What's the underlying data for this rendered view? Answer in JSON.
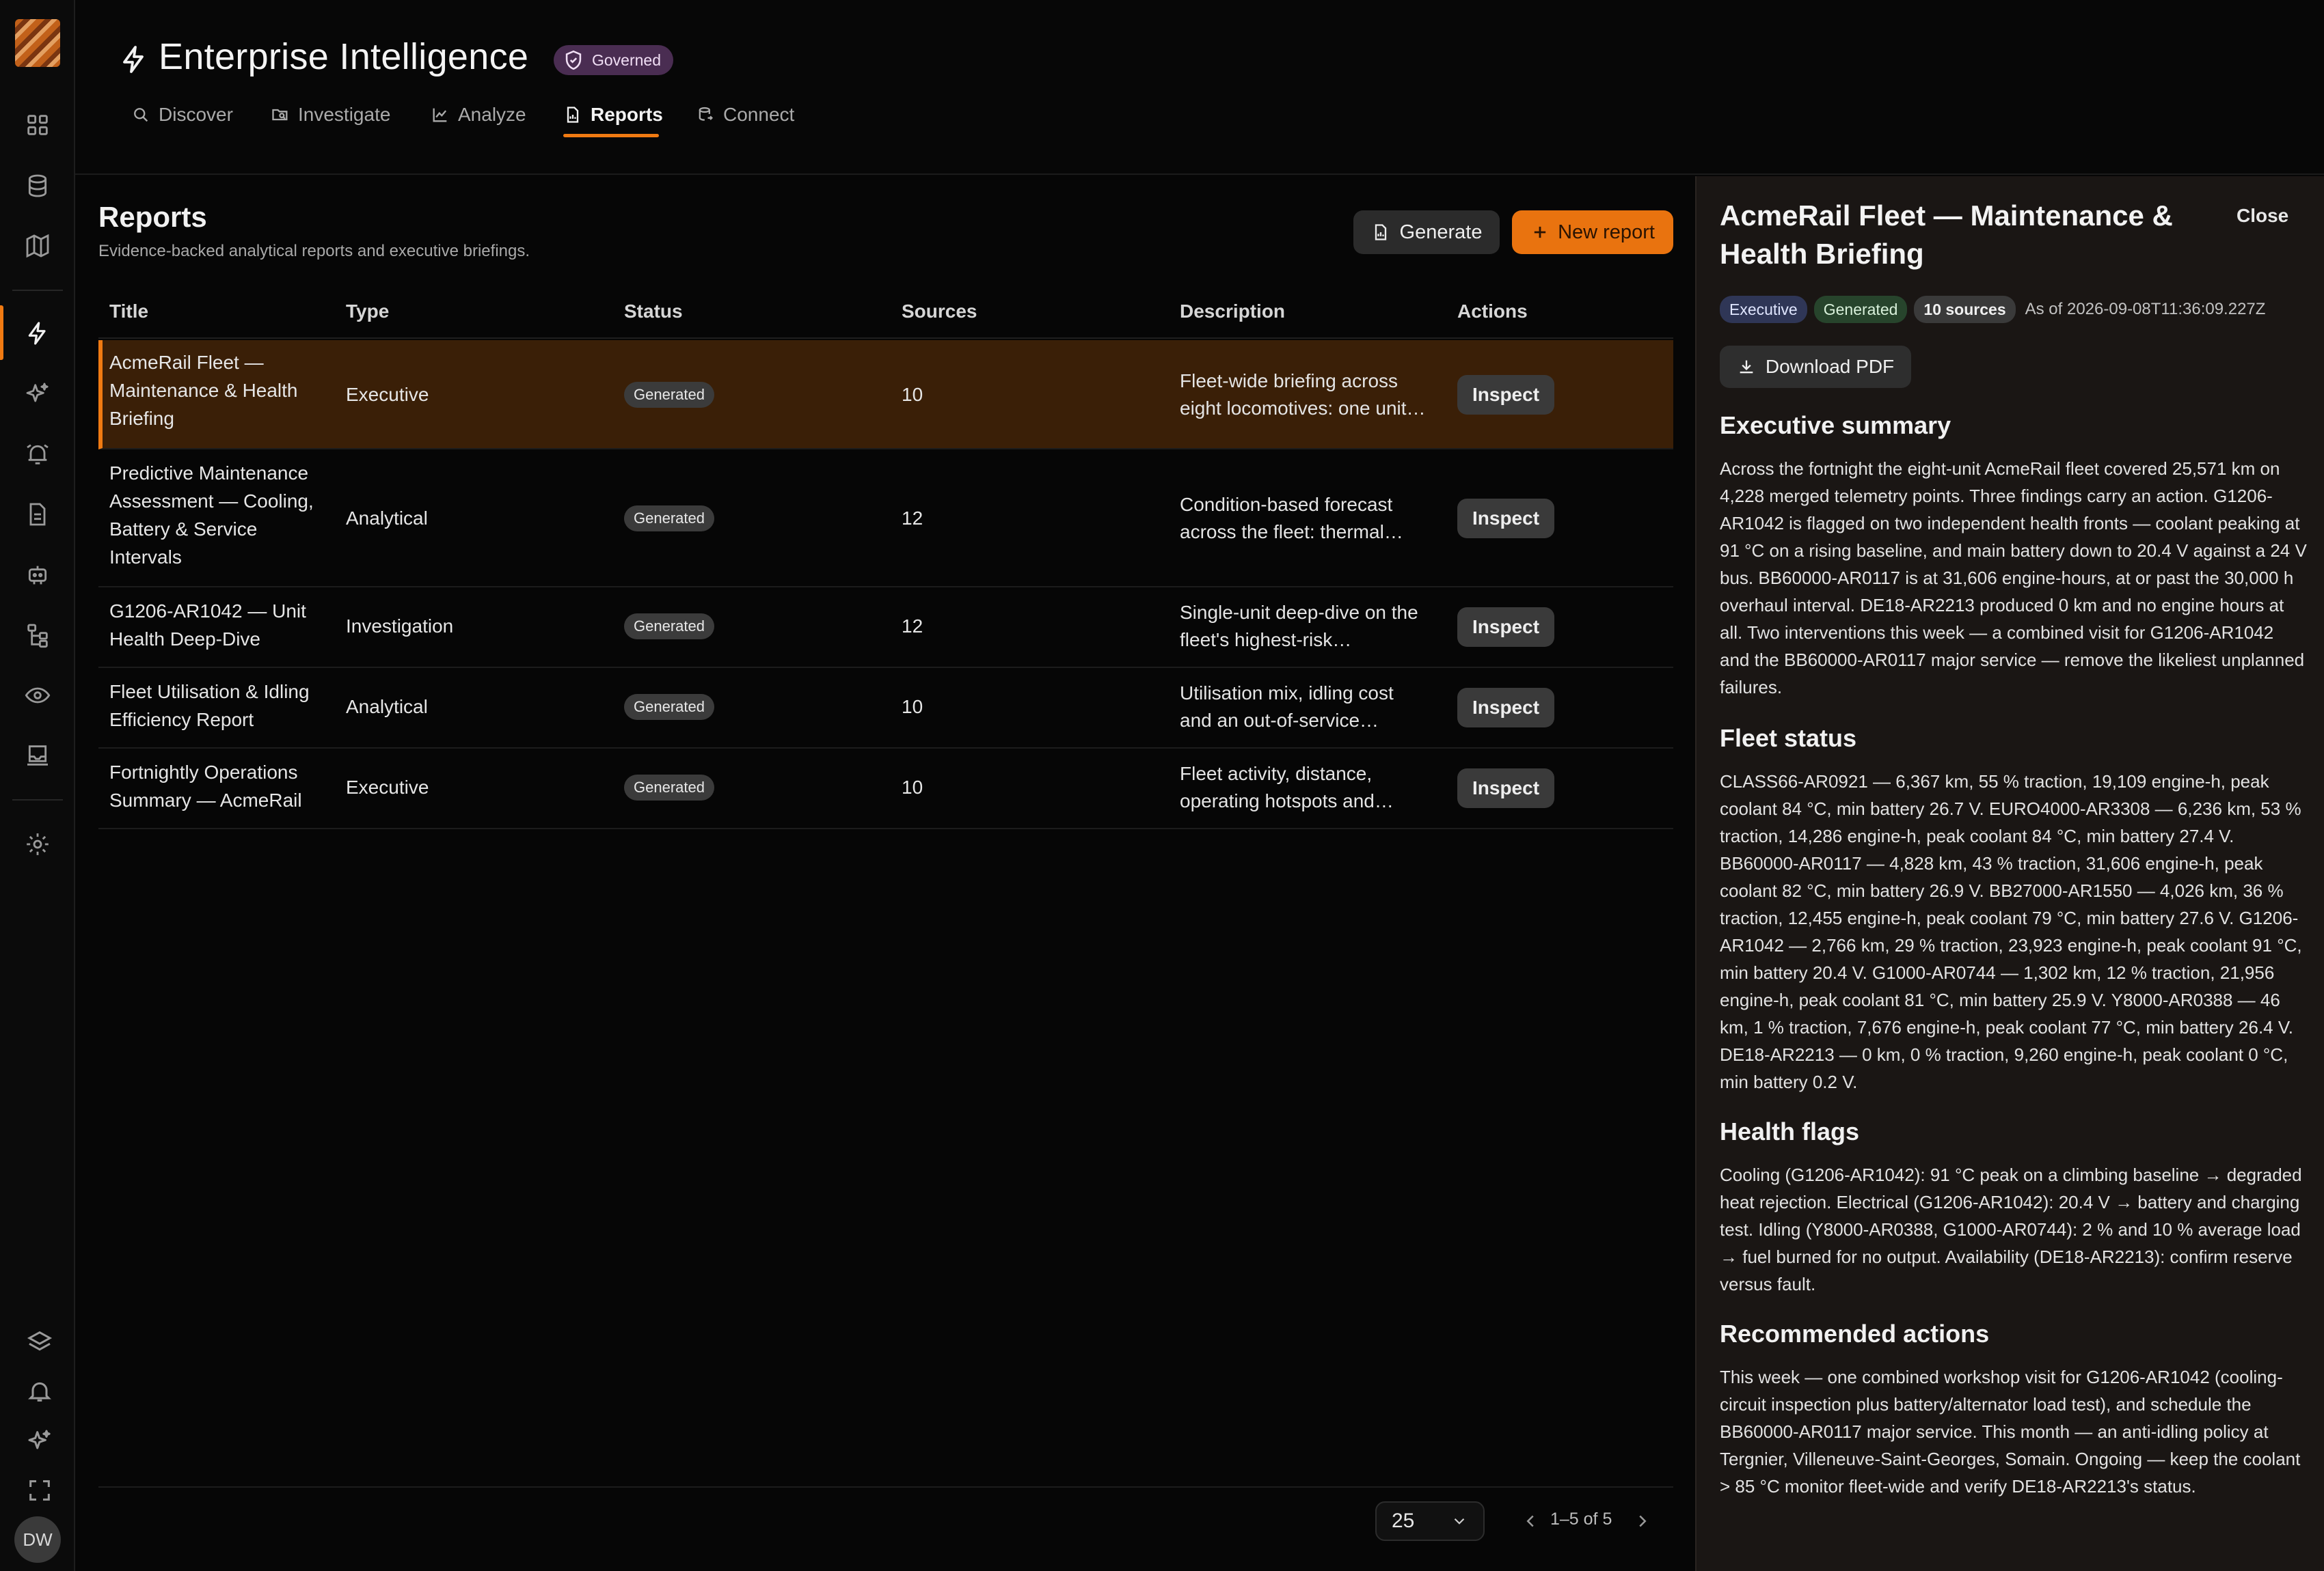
{
  "app": {
    "title": "Enterprise Intelligence",
    "badge": "Governed"
  },
  "tabs": [
    {
      "label": "Discover",
      "icon": "search-icon"
    },
    {
      "label": "Investigate",
      "icon": "folder-search-icon"
    },
    {
      "label": "Analyze",
      "icon": "chart-line-icon"
    },
    {
      "label": "Reports",
      "icon": "file-report-icon",
      "active": true
    },
    {
      "label": "Connect",
      "icon": "database-link-icon"
    }
  ],
  "sidebar": {
    "icons": [
      "dashboard-icon",
      "database-icon",
      "map-icon",
      "lightning-icon",
      "sparkles-icon",
      "alarm-icon",
      "document-icon",
      "robot-icon",
      "hierarchy-icon",
      "eye-icon",
      "inbox-icon",
      "settings-icon",
      "layers-icon",
      "bell-icon",
      "sparkles-icon",
      "fullscreen-icon"
    ],
    "avatar": "DW"
  },
  "page": {
    "title": "Reports",
    "subtitle": "Evidence-backed analytical reports and executive briefings."
  },
  "buttons": {
    "generate": "Generate",
    "new_report": "New report"
  },
  "table": {
    "columns": [
      "Title",
      "Type",
      "Status",
      "Sources",
      "Description",
      "Actions"
    ],
    "action_label": "Inspect",
    "rows": [
      {
        "title": "AcmeRail Fleet — Maintenance & Health Briefing",
        "type": "Executive",
        "status": "Generated",
        "sources": "10",
        "description": "Fleet-wide briefing across eight locomotives: one unit…",
        "selected": true
      },
      {
        "title": "Predictive Maintenance Assessment — Cooling, Battery & Service Intervals",
        "type": "Analytical",
        "status": "Generated",
        "sources": "12",
        "description": "Condition-based forecast across the fleet: thermal an…"
      },
      {
        "title": "G1206-AR1042 — Unit Health Deep-Dive",
        "type": "Investigation",
        "status": "Generated",
        "sources": "12",
        "description": "Single-unit deep-dive on the fleet's highest-risk…"
      },
      {
        "title": "Fleet Utilisation & Idling Efficiency Report",
        "type": "Analytical",
        "status": "Generated",
        "sources": "10",
        "description": "Utilisation mix, idling cost and an out-of-service asset…"
      },
      {
        "title": "Fortnightly Operations Summary — AcmeRail",
        "type": "Executive",
        "status": "Generated",
        "sources": "10",
        "description": "Fleet activity, distance, operating hotspots and…"
      }
    ]
  },
  "pagination": {
    "page_size": "25",
    "range": "1–5 of 5"
  },
  "panel": {
    "title": "AcmeRail Fleet — Maintenance & Health Briefing",
    "close": "Close",
    "chips": {
      "type": "Executive",
      "status": "Generated",
      "sources": "10 sources"
    },
    "as_of": "As of 2026-09-08T11:36:09.227Z",
    "download": "Download PDF",
    "sections": [
      {
        "heading": "Executive summary",
        "text": "Across the fortnight the eight-unit AcmeRail fleet covered 25,571 km on 4,228 merged telemetry points. Three findings carry an action. G1206-AR1042 is flagged on two independent health fronts — coolant peaking at 91 °C on a rising baseline, and main battery down to 20.4 V against a 24 V bus. BB60000-AR0117 is at 31,606 engine-hours, at or past the 30,000 h overhaul interval. DE18-AR2213 produced 0 km and no engine hours at all. Two interventions this week — a combined visit for G1206-AR1042 and the BB60000-AR0117 major service — remove the likeliest unplanned failures."
      },
      {
        "heading": "Fleet status",
        "text": "CLASS66-AR0921 — 6,367 km, 55 % traction, 19,109 engine-h, peak coolant 84 °C, min battery 26.7 V. EURO4000-AR3308 — 6,236 km, 53 % traction, 14,286 engine-h, peak coolant 84 °C, min battery 27.4 V. BB60000-AR0117 — 4,828 km, 43 % traction, 31,606 engine-h, peak coolant 82 °C, min battery 26.9 V. BB27000-AR1550 — 4,026 km, 36 % traction, 12,455 engine-h, peak coolant 79 °C, min battery 27.6 V. G1206-AR1042 — 2,766 km, 29 % traction, 23,923 engine-h, peak coolant 91 °C, min battery 20.4 V. G1000-AR0744 — 1,302 km, 12 % traction, 21,956 engine-h, peak coolant 81 °C, min battery 25.9 V. Y8000-AR0388 — 46 km, 1 % traction, 7,676 engine-h, peak coolant 77 °C, min battery 26.4 V. DE18-AR2213 — 0 km, 0 % traction, 9,260 engine-h, peak coolant 0 °C, min battery 0.2 V."
      },
      {
        "heading": "Health flags",
        "text": "Cooling (G1206-AR1042): 91 °C peak on a climbing baseline → degraded heat rejection. Electrical (G1206-AR1042): 20.4 V → battery and charging test. Idling (Y8000-AR0388, G1000-AR0744): 2 % and 10 % average load → fuel burned for no output. Availability (DE18-AR2213): confirm reserve versus fault."
      },
      {
        "heading": "Recommended actions",
        "text": "This week — one combined workshop visit for G1206-AR1042 (cooling-circuit inspection plus battery/alternator load test), and schedule the BB60000-AR0117 major service. This month — an anti-idling policy at Tergnier, Villeneuve-Saint-Georges, Somain. Ongoing — keep the coolant > 85 °C monitor fleet-wide and verify DE18-AR2213's status."
      }
    ]
  },
  "colors": {
    "accent": "#f07a12",
    "selected_row": "#3a1f07",
    "panel_bg": "#1a1614",
    "badge_governed": "#4a2d52"
  }
}
